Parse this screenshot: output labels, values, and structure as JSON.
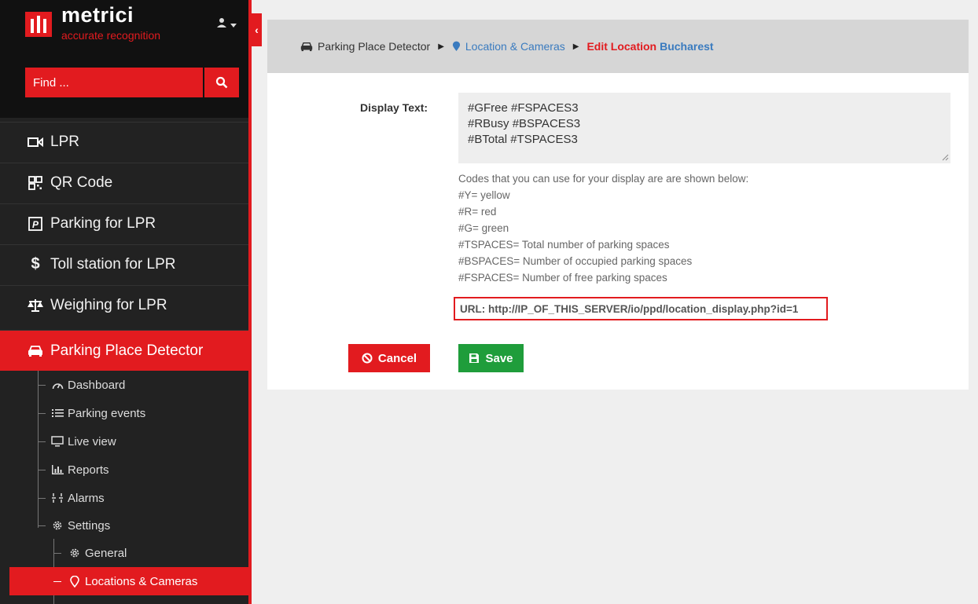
{
  "brand": {
    "name": "metrici",
    "tagline": "accurate recognition"
  },
  "search": {
    "placeholder": "Find ..."
  },
  "nav": [
    {
      "label": "LPR",
      "icon": "video-camera-icon"
    },
    {
      "label": "QR Code",
      "icon": "qr-code-icon"
    },
    {
      "label": "Parking for LPR",
      "icon": "parking-icon"
    },
    {
      "label": "Toll station for LPR",
      "icon": "dollar-icon"
    },
    {
      "label": "Weighing for LPR",
      "icon": "balance-scale-icon"
    },
    {
      "label": "Parking Place Detector",
      "icon": "car-icon",
      "active": true
    }
  ],
  "subnav": [
    {
      "label": "Dashboard",
      "icon": "dashboard-gauge-icon"
    },
    {
      "label": "Parking events",
      "icon": "list-icon"
    },
    {
      "label": "Live view",
      "icon": "monitor-icon"
    },
    {
      "label": "Reports",
      "icon": "bar-chart-icon"
    },
    {
      "label": "Alarms",
      "icon": "alarms-icon"
    },
    {
      "label": "Settings",
      "icon": "gear-icon"
    }
  ],
  "settings_subnav": [
    {
      "label": "General",
      "icon": "gear-icon"
    },
    {
      "label": "Locations & Cameras",
      "icon": "map-marker-icon",
      "active": true
    }
  ],
  "breadcrumb": {
    "root": "Parking Place Detector",
    "section": "Location & Cameras",
    "current": "Edit Location",
    "location": "Bucharest"
  },
  "form": {
    "display_text_label": "Display Text:",
    "display_text_lines": [
      "#GFree #FSPACES3",
      "#RBusy #BSPACES3",
      "#BTotal #TSPACES3"
    ],
    "help_lines": [
      "Codes that you can use for your display are are shown below:",
      "#Y= yellow",
      "#R= red",
      "#G= green",
      "#TSPACES= Total number of parking spaces",
      "#BSPACES= Number of occupied parking spaces",
      "#FSPACES= Number of free parking spaces"
    ],
    "url_text": "URL: http://IP_OF_THIS_SERVER/io/ppd/location_display.php?id=1",
    "cancel_label": "Cancel",
    "save_label": "Save"
  },
  "colors": {
    "accent": "#e21b1f",
    "save": "#1f9d3b",
    "link": "#3a7bbf",
    "sidebar": "#222222"
  }
}
